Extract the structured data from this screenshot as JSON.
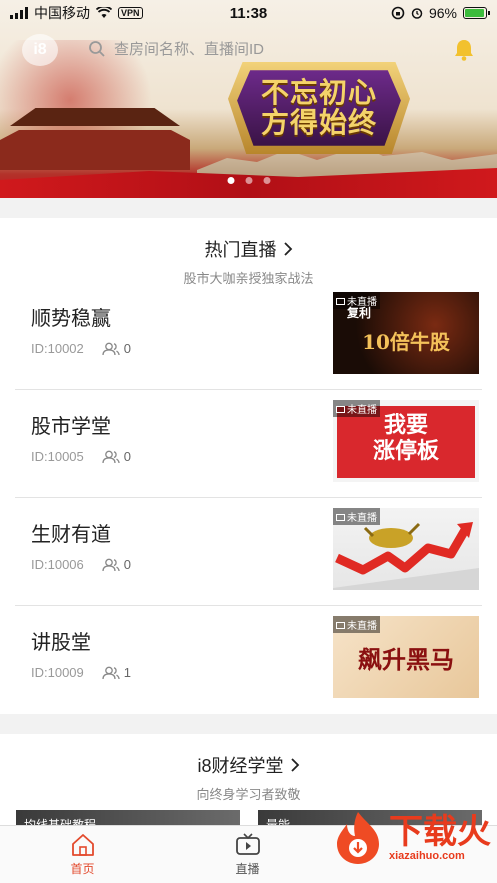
{
  "status_bar": {
    "carrier": "中国移动",
    "vpn": "VPN",
    "time": "11:38",
    "battery": "96%",
    "battery_level": 0.96
  },
  "header": {
    "logo": "i8",
    "search_placeholder": "查房间名称、直播间ID"
  },
  "banner": {
    "slogan_line1": "不忘初心",
    "slogan_line2": "方得始终",
    "slide_count": 3,
    "active_slide": 1
  },
  "hot_live": {
    "title": "热门直播",
    "subtitle": "股市大咖亲授独家战法",
    "rooms": [
      {
        "name": "顺势稳赢",
        "id": "ID:10002",
        "viewers": "0",
        "status": "未直播",
        "thumb_text": "10倍牛股",
        "thumb_tag": "复利"
      },
      {
        "name": "股市学堂",
        "id": "ID:10005",
        "viewers": "0",
        "status": "未直播",
        "thumb_text_1": "我要",
        "thumb_text_2": "涨停板"
      },
      {
        "name": "生财有道",
        "id": "ID:10006",
        "viewers": "0",
        "status": "未直播"
      },
      {
        "name": "讲股堂",
        "id": "ID:10009",
        "viewers": "1",
        "status": "未直播",
        "thumb_text": "飙升黑马"
      }
    ]
  },
  "academy": {
    "title": "i8财经学堂",
    "subtitle": "向终身学习者致敬",
    "courses": [
      "均线基础教程",
      "量能"
    ]
  },
  "tabbar": {
    "tabs": [
      {
        "label": "首页",
        "active": true
      },
      {
        "label": "直播",
        "active": false
      }
    ]
  },
  "watermark": {
    "name": "下载火",
    "url": "xiazaihuo.com"
  },
  "colors": {
    "accent": "#e34a2d",
    "banner_red": "#c1121b",
    "badge_gold": "#f4d36a"
  }
}
